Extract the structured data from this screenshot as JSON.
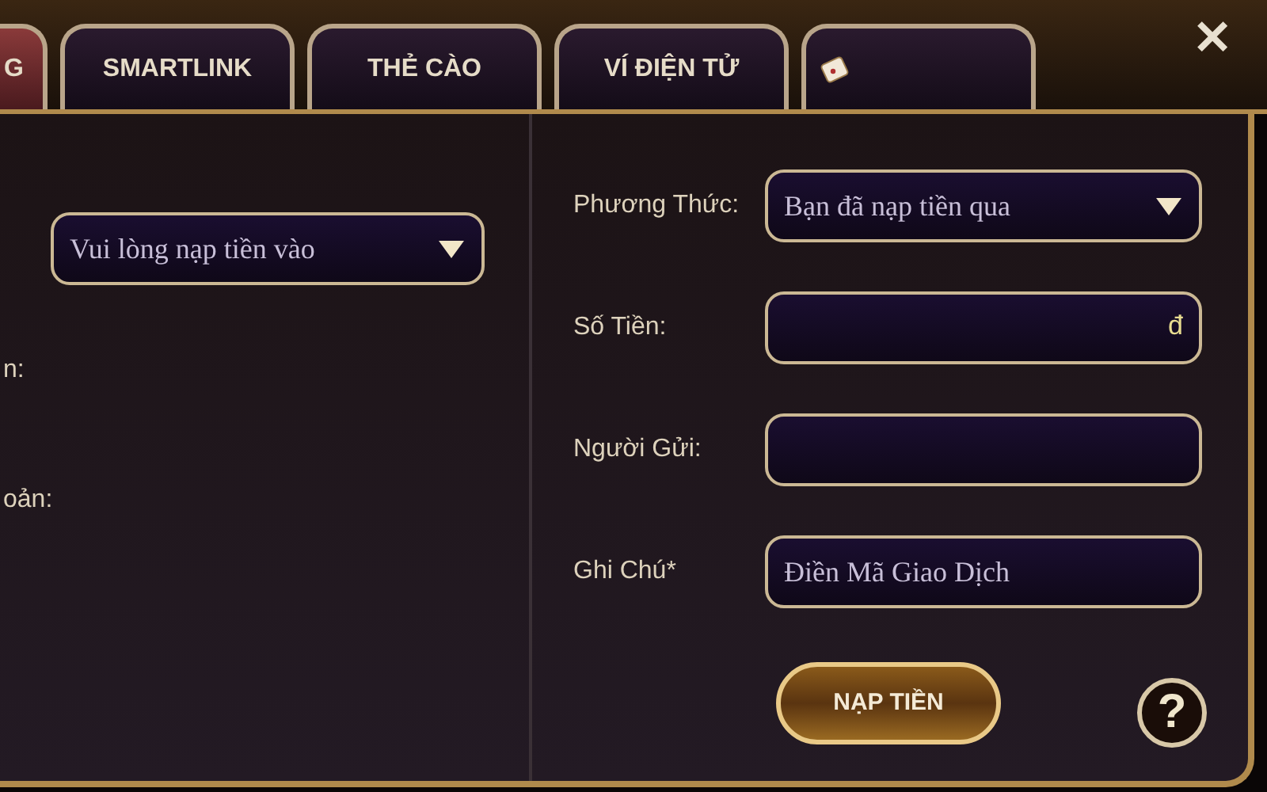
{
  "tabs": [
    {
      "label": "G",
      "selected": true
    },
    {
      "label": "SMARTLINK",
      "selected": false
    },
    {
      "label": "THẺ CÀO",
      "selected": false
    },
    {
      "label": "VÍ ĐIỆN TỬ",
      "selected": false
    },
    {
      "kind": "icon",
      "selected": false
    }
  ],
  "close": "✕",
  "left": {
    "select": {
      "value": "Vui lòng nạp tiền vào"
    },
    "labels": [
      "n:",
      "oản:"
    ]
  },
  "form": [
    {
      "kind": "select",
      "label": "Phương Thức:",
      "value": "Bạn đã nạp tiền qua"
    },
    {
      "kind": "input",
      "label": "Số Tiền:",
      "suffix": "đ"
    },
    {
      "kind": "input",
      "label": "Người Gửi:"
    },
    {
      "kind": "input",
      "label": "Ghi Chú*",
      "placeholder": "Điền Mã Giao Dịch"
    }
  ],
  "submit": "NẠP TIỀN",
  "help": "?"
}
